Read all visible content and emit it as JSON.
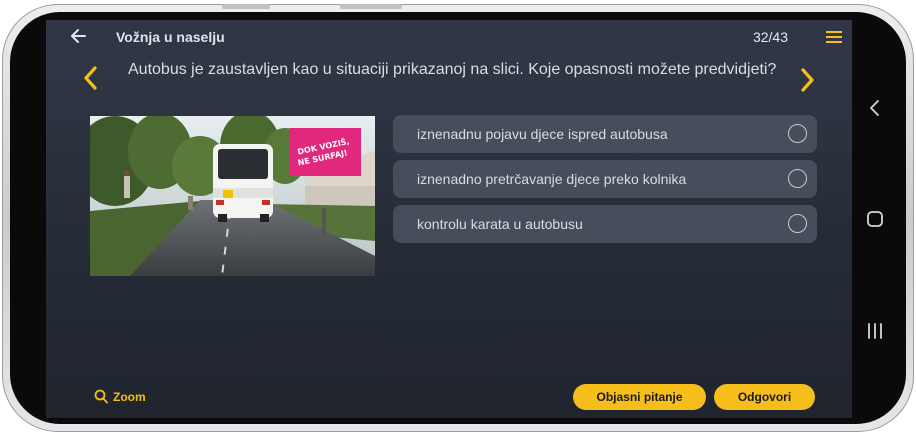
{
  "app": {
    "title": "Vožnja u naselju",
    "counter": "32/43"
  },
  "question": {
    "text": "Autobus je zaustavljen kao u situaciji prikazanoj na slici. Koje opasnosti možete predvidjeti?",
    "image_alt": "Autobus zaustavljen uz kolnik",
    "billboard_text": "DOK VOZIŠ, NE SURFAJ!"
  },
  "answers": [
    {
      "label": "iznenadnu pojavu djece ispred autobusa",
      "selected": false
    },
    {
      "label": "iznenadno pretrčavanje djece preko kolnika",
      "selected": false
    },
    {
      "label": "kontrolu karata u autobusu",
      "selected": false
    }
  ],
  "footer": {
    "zoom_label": "Zoom",
    "explain_label": "Objasni pitanje",
    "answer_label": "Odgovori"
  },
  "icons": {
    "back": "arrow-left-icon",
    "menu": "hamburger-menu-icon",
    "prev": "chevron-left-icon",
    "next": "chevron-right-icon",
    "zoom": "search-icon",
    "android_back": "android-back-icon",
    "android_home": "android-home-icon",
    "android_recents": "android-recents-icon"
  },
  "colors": {
    "accent": "#f6be1a",
    "background": "#2b313d",
    "answer_bg": "#474d5b",
    "billboard": "#e2287e"
  }
}
